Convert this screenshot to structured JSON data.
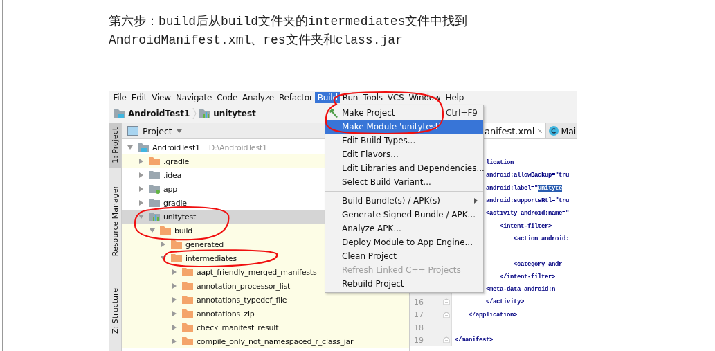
{
  "paragraph": {
    "lines": [
      "第六步：build后从build文件夹的intermediates文件中找到",
      "AndroidManifest.xml、res文件夹和class.jar"
    ]
  },
  "ide": {
    "menu_bar": [
      {
        "label": "File",
        "selected": false
      },
      {
        "label": "Edit",
        "selected": false
      },
      {
        "label": "View",
        "selected": false
      },
      {
        "label": "Navigate",
        "selected": false
      },
      {
        "label": "Code",
        "selected": false
      },
      {
        "label": "Analyze",
        "selected": false
      },
      {
        "label": "Refactor",
        "selected": false
      },
      {
        "label": "Build",
        "selected": true
      },
      {
        "label": "Run",
        "selected": false
      },
      {
        "label": "Tools",
        "selected": false
      },
      {
        "label": "VCS",
        "selected": false
      },
      {
        "label": "Window",
        "selected": false
      },
      {
        "label": "Help",
        "selected": false
      }
    ],
    "breadcrumb": [
      {
        "label": "AndroidTest1",
        "kind": "project"
      },
      {
        "label": "unitytest",
        "kind": "module"
      }
    ],
    "side_tabs": [
      {
        "label": "1: Project",
        "selected": true
      },
      {
        "label": "Resource Manager",
        "selected": false
      },
      {
        "label": "Z: Structure",
        "selected": false
      }
    ],
    "project_panel": {
      "title": "Project",
      "tree": [
        {
          "label": "AndroidTest1",
          "path": "D:\\AndroidTest1",
          "kind": "project",
          "expanded": true,
          "selected": false,
          "excluded": false,
          "children": [
            {
              "label": ".gradle",
              "kind": "folder",
              "expanded": false,
              "selected": false,
              "excluded": true
            },
            {
              "label": ".idea",
              "kind": "folder",
              "expanded": false,
              "selected": false,
              "excluded": false
            },
            {
              "label": "app",
              "kind": "app-module",
              "expanded": false,
              "selected": false,
              "excluded": false
            },
            {
              "label": "gradle",
              "kind": "folder",
              "expanded": false,
              "selected": false,
              "excluded": false
            },
            {
              "label": "unitytest",
              "kind": "module",
              "expanded": true,
              "selected": true,
              "excluded": false,
              "children": [
                {
                  "label": "build",
                  "kind": "folder",
                  "expanded": true,
                  "selected": false,
                  "excluded": true,
                  "children": [
                    {
                      "label": "generated",
                      "kind": "folder",
                      "expanded": false,
                      "selected": false,
                      "excluded": true
                    },
                    {
                      "label": "intermediates",
                      "kind": "folder",
                      "expanded": true,
                      "selected": false,
                      "excluded": true,
                      "children": [
                        {
                          "label": "aapt_friendly_merged_manifests",
                          "kind": "folder",
                          "expanded": false,
                          "selected": false,
                          "excluded": true
                        },
                        {
                          "label": "annotation_processor_list",
                          "kind": "folder",
                          "expanded": false,
                          "selected": false,
                          "excluded": true
                        },
                        {
                          "label": "annotations_typedef_file",
                          "kind": "folder",
                          "expanded": false,
                          "selected": false,
                          "excluded": true
                        },
                        {
                          "label": "annotations_zip",
                          "kind": "folder",
                          "expanded": false,
                          "selected": false,
                          "excluded": true
                        },
                        {
                          "label": "check_manifest_result",
                          "kind": "folder",
                          "expanded": false,
                          "selected": false,
                          "excluded": true
                        },
                        {
                          "label": "compile_only_not_namespaced_r_class_jar",
                          "kind": "folder",
                          "expanded": false,
                          "selected": false,
                          "excluded": true
                        }
                      ]
                    }
                  ]
                }
              ]
            }
          ]
        }
      ]
    },
    "editor_tabs": [
      {
        "label": "anifest.xml",
        "kind": "xml",
        "selected": true
      },
      {
        "label": "Mai",
        "kind": "class",
        "selected": false
      }
    ],
    "code_lines": [
      {
        "text": "         lication"
      },
      {
        "text": "         android:allowBackup=\"tru"
      },
      {
        "text": "         android:label=\"",
        "highlight": "unityte"
      },
      {
        "text": "         android:supportsRtl=\"tru"
      },
      {
        "text": "         <activity android:name=\""
      },
      {
        "text": "             <intent-filter>"
      },
      {
        "text": "                 <action android:"
      },
      {
        "kind": "blank"
      },
      {
        "text": "                 <category andr"
      },
      {
        "text": "             </intent-filter>"
      },
      {
        "text": "         <meta-data android:n"
      },
      {
        "number": "16",
        "text": "         </activity>",
        "fold": true
      },
      {
        "number": "17",
        "text": "    </application>",
        "fold": true
      },
      {
        "number": "18"
      },
      {
        "number": "19",
        "text": "</manifest>",
        "fold": true
      }
    ],
    "build_menu": [
      {
        "kind": "item",
        "label": "Make Project",
        "shortcut": "Ctrl+F9",
        "icon": true,
        "selected": false,
        "disabled": false,
        "submenu": false
      },
      {
        "kind": "item",
        "label": "Make Module 'unitytest'",
        "selected": true,
        "disabled": false,
        "submenu": false
      },
      {
        "kind": "item",
        "label": "Edit Build Types...",
        "selected": false,
        "disabled": false,
        "submenu": false
      },
      {
        "kind": "item",
        "label": "Edit Flavors...",
        "selected": false,
        "disabled": false,
        "submenu": false
      },
      {
        "kind": "item",
        "label": "Edit Libraries and Dependencies...",
        "selected": false,
        "disabled": false,
        "submenu": false
      },
      {
        "kind": "item",
        "label": "Select Build Variant...",
        "selected": false,
        "disabled": false,
        "submenu": false
      },
      {
        "kind": "separator"
      },
      {
        "kind": "item",
        "label": "Build Bundle(s) / APK(s)",
        "selected": false,
        "disabled": false,
        "submenu": true
      },
      {
        "kind": "item",
        "label": "Generate Signed Bundle / APK...",
        "selected": false,
        "disabled": false,
        "submenu": false
      },
      {
        "kind": "item",
        "label": "Analyze APK...",
        "selected": false,
        "disabled": false,
        "submenu": false
      },
      {
        "kind": "item",
        "label": "Deploy Module to App Engine...",
        "selected": false,
        "disabled": false,
        "submenu": false
      },
      {
        "kind": "item",
        "label": "Clean Project",
        "selected": false,
        "disabled": false,
        "submenu": false
      },
      {
        "kind": "item",
        "label": "Refresh Linked C++ Projects",
        "selected": false,
        "disabled": true,
        "submenu": false
      },
      {
        "kind": "item",
        "label": "Rebuild Project",
        "selected": false,
        "disabled": false,
        "submenu": false
      }
    ]
  }
}
